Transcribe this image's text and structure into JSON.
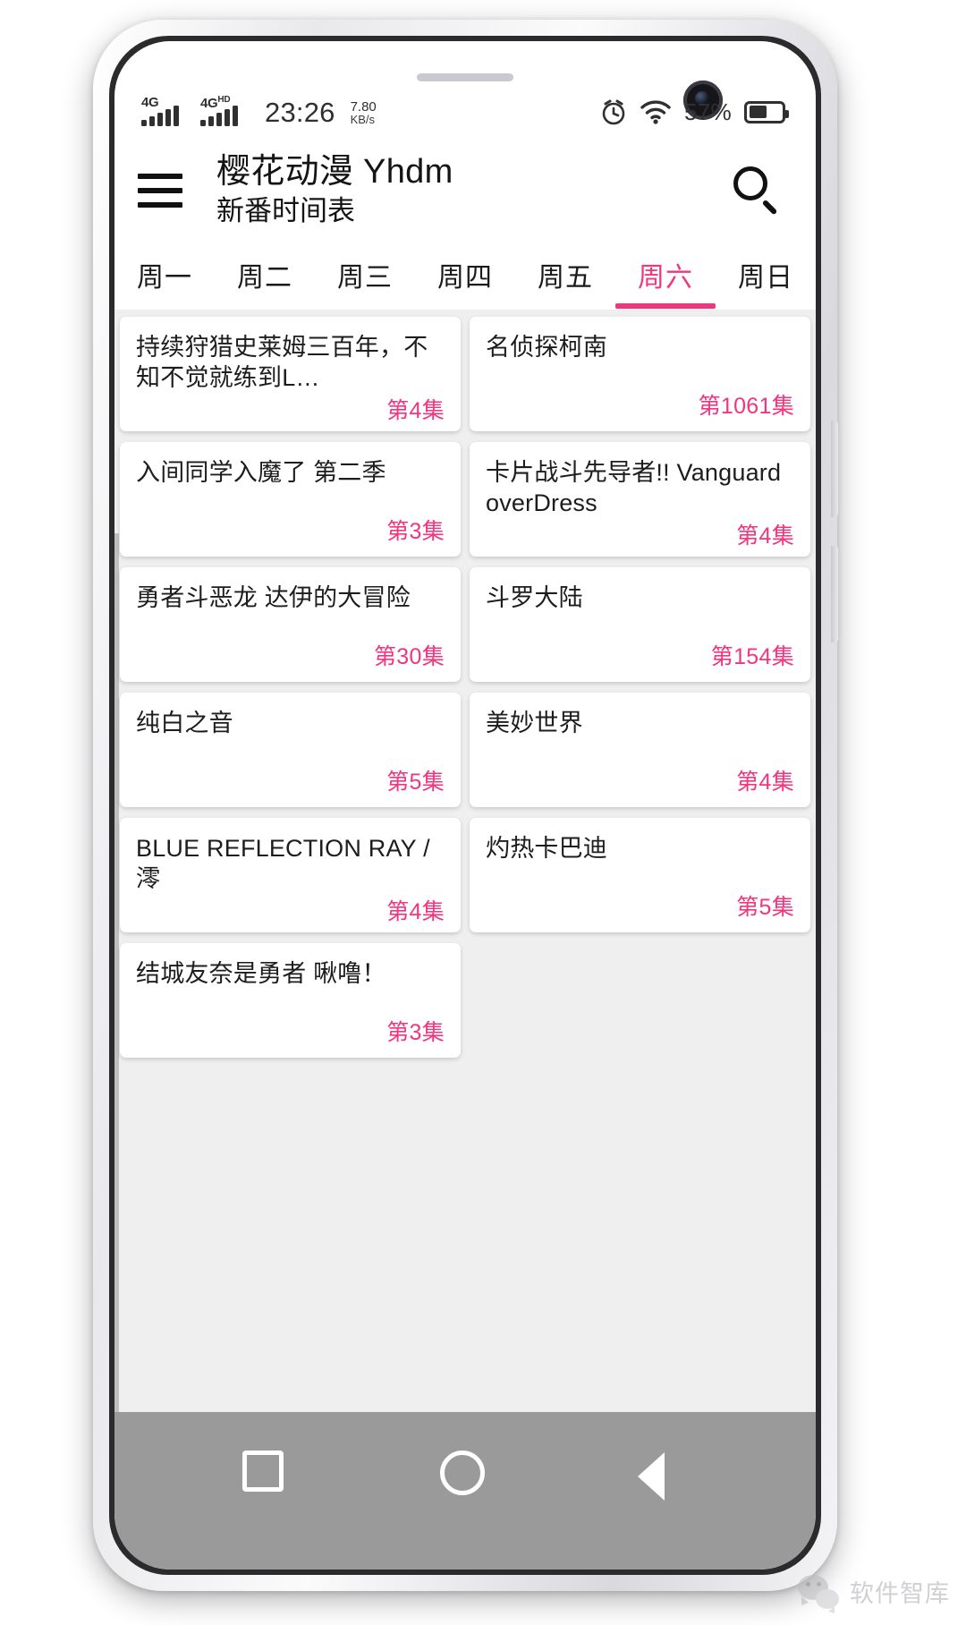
{
  "status_bar": {
    "network_1": "4G",
    "network_1_sup": "",
    "network_2": "4G",
    "network_2_sup": "HD",
    "clock": "23:26",
    "net_speed": "7.80",
    "net_speed_unit": "KB/s",
    "alarm_icon": "alarm-clock-icon",
    "wifi_icon": "wifi-icon",
    "battery_text": "57%",
    "battery_percent": 57
  },
  "app_bar": {
    "menu_icon": "hamburger-menu-icon",
    "title": "樱花动漫 Yhdm",
    "subtitle": "新番时间表",
    "search_icon": "search-icon"
  },
  "tabs": [
    {
      "label": "周一",
      "active": false
    },
    {
      "label": "周二",
      "active": false
    },
    {
      "label": "周三",
      "active": false
    },
    {
      "label": "周四",
      "active": false
    },
    {
      "label": "周五",
      "active": false
    },
    {
      "label": "周六",
      "active": true
    },
    {
      "label": "周日",
      "active": false
    }
  ],
  "colors": {
    "accent_pink": "#f2357f",
    "content_background": "#efeff0",
    "card_background": "#ffffff",
    "text_primary": "#1d1d1d",
    "nav_bar": "#9a9a9a"
  },
  "anime_list": [
    {
      "title": "持续狩猎史莱姆三百年，不知不觉就练到L…",
      "episode": "第4集"
    },
    {
      "title": "名侦探柯南",
      "episode": "第1061集"
    },
    {
      "title": "入间同学入魔了 第二季",
      "episode": "第3集"
    },
    {
      "title": "卡片战斗先导者!! Vanguard overDress",
      "episode": "第4集"
    },
    {
      "title": "勇者斗恶龙 达伊的大冒险",
      "episode": "第30集"
    },
    {
      "title": "斗罗大陆",
      "episode": "第154集"
    },
    {
      "title": "纯白之音",
      "episode": "第5集"
    },
    {
      "title": "美妙世界",
      "episode": "第4集"
    },
    {
      "title": "BLUE REFLECTION RAY / 澪",
      "episode": "第4集"
    },
    {
      "title": "灼热卡巴迪",
      "episode": "第5集"
    },
    {
      "title": "结城友奈是勇者 啾噜！",
      "episode": "第3集"
    }
  ],
  "nav_bar": {
    "recents_icon": "square-recents-icon",
    "home_icon": "circle-home-icon",
    "back_icon": "triangle-back-icon"
  },
  "watermark": {
    "icon": "wechat-icon",
    "text": "软件智库"
  }
}
